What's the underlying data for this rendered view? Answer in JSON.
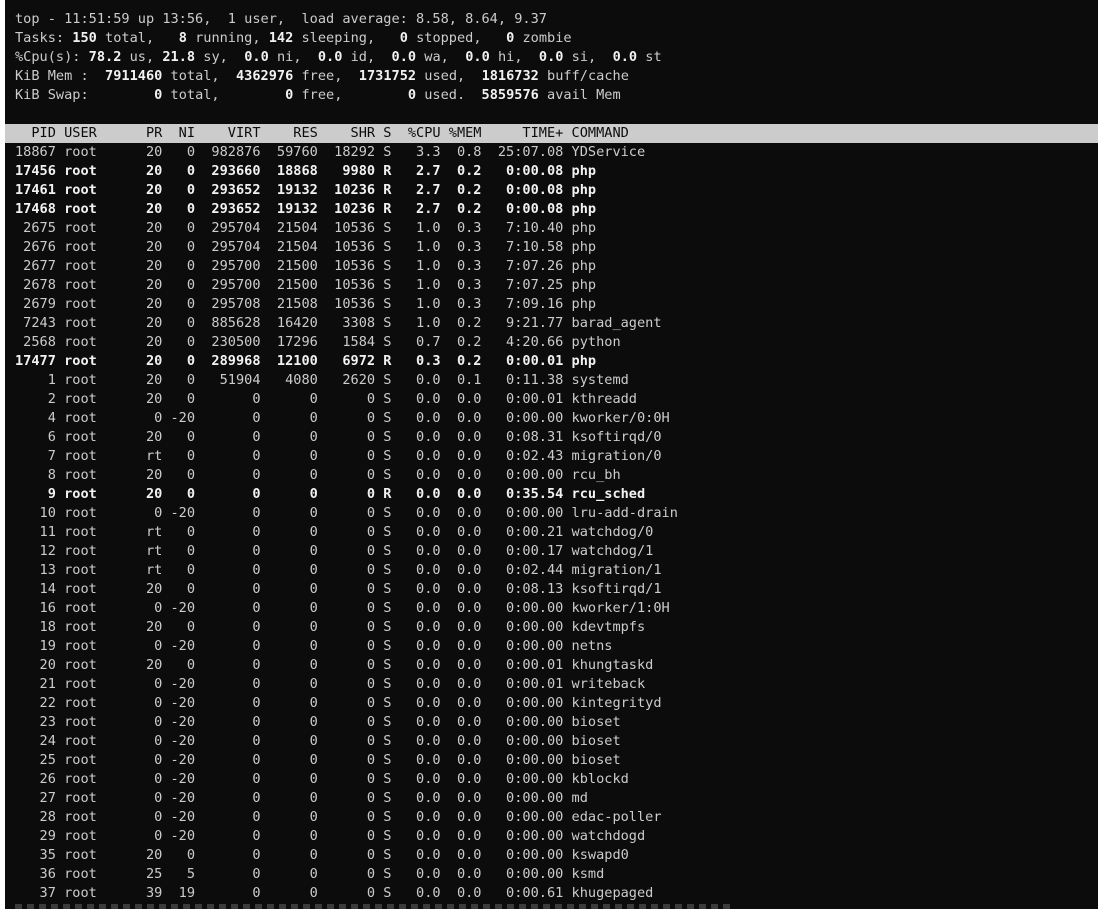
{
  "summary": [
    {
      "parts": [
        {
          "t": "top - 11:51:59 up 13:56,  1 user,  load average: 8.58, 8.64, 9.37"
        }
      ]
    },
    {
      "parts": [
        {
          "t": "Tasks: "
        },
        {
          "t": "150",
          "b": true
        },
        {
          "t": " total,   "
        },
        {
          "t": "8",
          "b": true
        },
        {
          "t": " running, "
        },
        {
          "t": "142",
          "b": true
        },
        {
          "t": " sleeping,   "
        },
        {
          "t": "0",
          "b": true
        },
        {
          "t": " stopped,   "
        },
        {
          "t": "0",
          "b": true
        },
        {
          "t": " zombie"
        }
      ]
    },
    {
      "parts": [
        {
          "t": "%Cpu(s): "
        },
        {
          "t": "78.2",
          "b": true
        },
        {
          "t": " us, "
        },
        {
          "t": "21.8",
          "b": true
        },
        {
          "t": " sy,  "
        },
        {
          "t": "0.0",
          "b": true
        },
        {
          "t": " ni,  "
        },
        {
          "t": "0.0",
          "b": true
        },
        {
          "t": " id,  "
        },
        {
          "t": "0.0",
          "b": true
        },
        {
          "t": " wa,  "
        },
        {
          "t": "0.0",
          "b": true
        },
        {
          "t": " hi,  "
        },
        {
          "t": "0.0",
          "b": true
        },
        {
          "t": " si,  "
        },
        {
          "t": "0.0",
          "b": true
        },
        {
          "t": " st"
        }
      ]
    },
    {
      "parts": [
        {
          "t": "KiB Mem :  "
        },
        {
          "t": "7911460",
          "b": true
        },
        {
          "t": " total,  "
        },
        {
          "t": "4362976",
          "b": true
        },
        {
          "t": " free,  "
        },
        {
          "t": "1731752",
          "b": true
        },
        {
          "t": " used,  "
        },
        {
          "t": "1816732",
          "b": true
        },
        {
          "t": " buff/cache"
        }
      ]
    },
    {
      "parts": [
        {
          "t": "KiB Swap:        "
        },
        {
          "t": "0",
          "b": true
        },
        {
          "t": " total,        "
        },
        {
          "t": "0",
          "b": true
        },
        {
          "t": " free,        "
        },
        {
          "t": "0",
          "b": true
        },
        {
          "t": " used.  "
        },
        {
          "t": "5859576",
          "b": true
        },
        {
          "t": " avail Mem"
        }
      ]
    }
  ],
  "table": {
    "header": "  PID USER      PR  NI    VIRT    RES    SHR S  %CPU %MEM     TIME+ COMMAND",
    "rows": [
      {
        "text": "18867 root      20   0  982876  59760  18292 S   3.3  0.8  25:07.08 YDService",
        "bold": false
      },
      {
        "text": "17456 root      20   0  293660  18868   9980 R   2.7  0.2   0:00.08 php",
        "bold": true
      },
      {
        "text": "17461 root      20   0  293652  19132  10236 R   2.7  0.2   0:00.08 php",
        "bold": true
      },
      {
        "text": "17468 root      20   0  293652  19132  10236 R   2.7  0.2   0:00.08 php",
        "bold": true
      },
      {
        "text": " 2675 root      20   0  295704  21504  10536 S   1.0  0.3   7:10.40 php",
        "bold": false
      },
      {
        "text": " 2676 root      20   0  295704  21504  10536 S   1.0  0.3   7:10.58 php",
        "bold": false
      },
      {
        "text": " 2677 root      20   0  295700  21500  10536 S   1.0  0.3   7:07.26 php",
        "bold": false
      },
      {
        "text": " 2678 root      20   0  295700  21500  10536 S   1.0  0.3   7:07.25 php",
        "bold": false
      },
      {
        "text": " 2679 root      20   0  295708  21508  10536 S   1.0  0.3   7:09.16 php",
        "bold": false
      },
      {
        "text": " 7243 root      20   0  885628  16420   3308 S   1.0  0.2   9:21.77 barad_agent",
        "bold": false
      },
      {
        "text": " 2568 root      20   0  230500  17296   1584 S   0.7  0.2   4:20.66 python",
        "bold": false
      },
      {
        "text": "17477 root      20   0  289968  12100   6972 R   0.3  0.2   0:00.01 php",
        "bold": true
      },
      {
        "text": "    1 root      20   0   51904   4080   2620 S   0.0  0.1   0:11.38 systemd",
        "bold": false
      },
      {
        "text": "    2 root      20   0       0      0      0 S   0.0  0.0   0:00.01 kthreadd",
        "bold": false
      },
      {
        "text": "    4 root       0 -20       0      0      0 S   0.0  0.0   0:00.00 kworker/0:0H",
        "bold": false
      },
      {
        "text": "    6 root      20   0       0      0      0 S   0.0  0.0   0:08.31 ksoftirqd/0",
        "bold": false
      },
      {
        "text": "    7 root      rt   0       0      0      0 S   0.0  0.0   0:02.43 migration/0",
        "bold": false
      },
      {
        "text": "    8 root      20   0       0      0      0 S   0.0  0.0   0:00.00 rcu_bh",
        "bold": false
      },
      {
        "text": "    9 root      20   0       0      0      0 R   0.0  0.0   0:35.54 rcu_sched",
        "bold": true
      },
      {
        "text": "   10 root       0 -20       0      0      0 S   0.0  0.0   0:00.00 lru-add-drain",
        "bold": false
      },
      {
        "text": "   11 root      rt   0       0      0      0 S   0.0  0.0   0:00.21 watchdog/0",
        "bold": false
      },
      {
        "text": "   12 root      rt   0       0      0      0 S   0.0  0.0   0:00.17 watchdog/1",
        "bold": false
      },
      {
        "text": "   13 root      rt   0       0      0      0 S   0.0  0.0   0:02.44 migration/1",
        "bold": false
      },
      {
        "text": "   14 root      20   0       0      0      0 S   0.0  0.0   0:08.13 ksoftirqd/1",
        "bold": false
      },
      {
        "text": "   16 root       0 -20       0      0      0 S   0.0  0.0   0:00.00 kworker/1:0H",
        "bold": false
      },
      {
        "text": "   18 root      20   0       0      0      0 S   0.0  0.0   0:00.00 kdevtmpfs",
        "bold": false
      },
      {
        "text": "   19 root       0 -20       0      0      0 S   0.0  0.0   0:00.00 netns",
        "bold": false
      },
      {
        "text": "   20 root      20   0       0      0      0 S   0.0  0.0   0:00.01 khungtaskd",
        "bold": false
      },
      {
        "text": "   21 root       0 -20       0      0      0 S   0.0  0.0   0:00.01 writeback",
        "bold": false
      },
      {
        "text": "   22 root       0 -20       0      0      0 S   0.0  0.0   0:00.00 kintegrityd",
        "bold": false
      },
      {
        "text": "   23 root       0 -20       0      0      0 S   0.0  0.0   0:00.00 bioset",
        "bold": false
      },
      {
        "text": "   24 root       0 -20       0      0      0 S   0.0  0.0   0:00.00 bioset",
        "bold": false
      },
      {
        "text": "   25 root       0 -20       0      0      0 S   0.0  0.0   0:00.00 bioset",
        "bold": false
      },
      {
        "text": "   26 root       0 -20       0      0      0 S   0.0  0.0   0:00.00 kblockd",
        "bold": false
      },
      {
        "text": "   27 root       0 -20       0      0      0 S   0.0  0.0   0:00.00 md",
        "bold": false
      },
      {
        "text": "   28 root       0 -20       0      0      0 S   0.0  0.0   0:00.00 edac-poller",
        "bold": false
      },
      {
        "text": "   29 root       0 -20       0      0      0 S   0.0  0.0   0:00.00 watchdogd",
        "bold": false
      },
      {
        "text": "   35 root      20   0       0      0      0 S   0.0  0.0   0:00.00 kswapd0",
        "bold": false
      },
      {
        "text": "   36 root      25   5       0      0      0 S   0.0  0.0   0:00.00 ksmd",
        "bold": false
      },
      {
        "text": "   37 root      39  19       0      0      0 S   0.0  0.0   0:00.61 khugepaged",
        "bold": false
      }
    ]
  },
  "colors": {
    "terminal_bg": "#0c0c0c",
    "text": "#cccccc",
    "bold_text": "#f2f2f2",
    "header_bg": "#cccccc"
  }
}
